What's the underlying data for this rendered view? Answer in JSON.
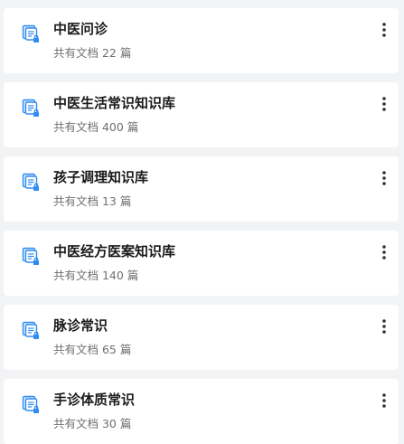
{
  "knowledge_bases": [
    {
      "title": "中医问诊",
      "count": "共有文档 22 篇"
    },
    {
      "title": "中医生活常识知识库",
      "count": "共有文档 400 篇"
    },
    {
      "title": "孩子调理知识库",
      "count": "共有文档 13 篇"
    },
    {
      "title": "中医经方医案知识库",
      "count": "共有文档 140 篇"
    },
    {
      "title": "脉诊常识",
      "count": "共有文档 65 篇"
    },
    {
      "title": "手诊体质常识",
      "count": "共有文档 30 篇"
    }
  ],
  "icons": {
    "item_icon": "knowledge-base-lock-icon",
    "more_icon": "more-vertical-icon"
  },
  "colors": {
    "icon_blue": "#2f8cf0",
    "icon_light": "#d6e9fd",
    "title": "#1a1a1a",
    "count": "#707070",
    "background": "#f2f3f5"
  }
}
